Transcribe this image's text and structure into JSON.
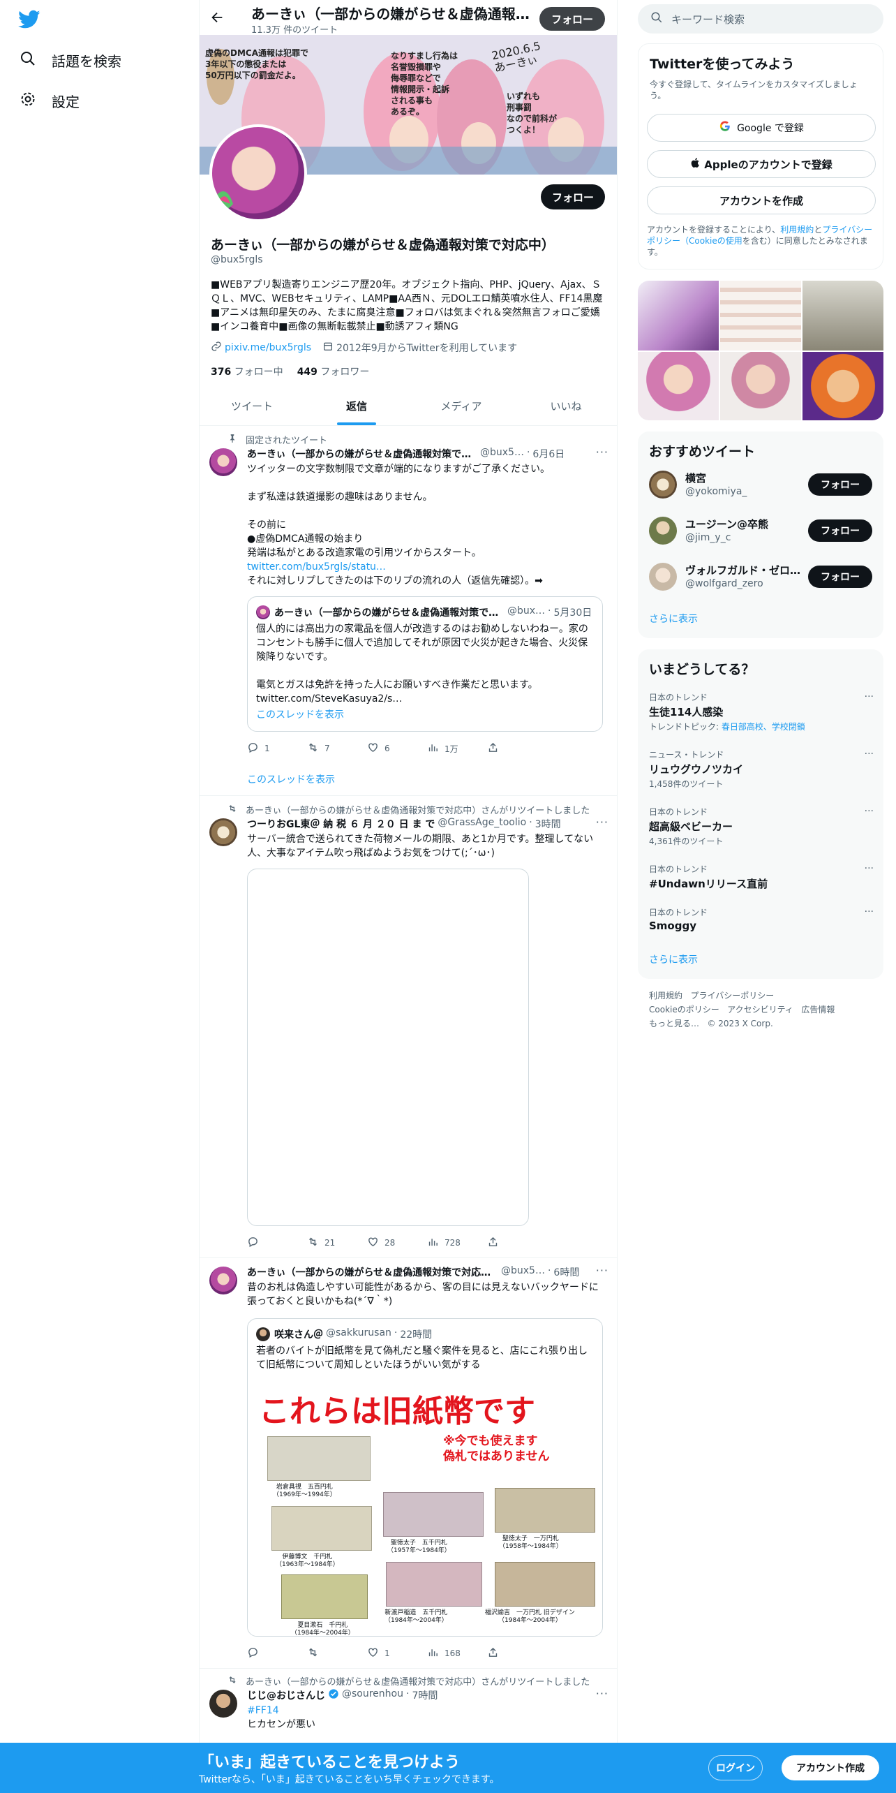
{
  "nav": {
    "search": "話題を検索",
    "settings": "設定"
  },
  "topbar": {
    "name": "あーきぃ（一部からの嫌がらせ＆虚偽通報対策で対応中）",
    "count": "11.3万 件のツイート",
    "follow": "フォロー"
  },
  "banner": {
    "caption1": "虚偽のDMCA通報は犯罪で\n3年以下の懲役または\n50万円以下の罰金だよ。",
    "caption2": "なりすまし行為は\n名誉毀損罪や\n侮辱罪などで\n情報開示・起訴\nされる事も\nあるぞ。",
    "caption3": "いずれも\n刑事罰\nなので前科が\nつくよ！",
    "signature": "2020.6.5\nあーきぃ"
  },
  "profile": {
    "name": "あーきぃ（一部からの嫌がらせ＆虚偽通報対策で対応中）",
    "handle": "@bux5rgls",
    "bio": "■WEBアプリ製造寄りエンジニア歴20年。オブジェクト指向、PHP、jQuery、Ajax、ＳＱＬ、MVC、WEBセキュリティ、LAMP■AA西Ｎ、元DOLエロ鯖英噴水住人、FF14黒魔■アニメは無印星矢のみ、たまに腐臭注意■フォロバは気まぐれ＆突然無言フォロご愛嬌■インコ養育中■画像の無断転載禁止■動誘アフィ類NG",
    "link": "pixiv.me/bux5rgls",
    "joined": "2012年9月からTwitterを利用しています",
    "following_count": "376",
    "following_label": "フォロー中",
    "followers_count": "449",
    "followers_label": "フォロワー",
    "follow": "フォロー"
  },
  "tabs": [
    "ツイート",
    "返信",
    "メディア",
    "いいね"
  ],
  "tweets": [
    {
      "social": "固定されたツイート",
      "name": "あーきぃ（一部からの嫌がらせ＆虚偽通報対策で対応中）",
      "handle": "@bux5…",
      "time": "6月6日",
      "text": "ツイッターの文字数制限で文章が端的になりますがご了承ください。\n\nまず私達は鉄道撮影の趣味はありません。\n\nその前に\n●虚偽DMCA通報の始まり\n発端は私がとある改造家電の引用ツイからスタート。",
      "link": "twitter.com/bux5rgls/statu…",
      "text2": "それに対しリプしてきたのは下のリプの流れの人（返信先確認）。➡",
      "quote": {
        "name": "あーきぃ（一部からの嫌がらせ＆虚偽通報対策で対応中）",
        "handle": "@bux…",
        "time": "5月30日",
        "text": "個人的には高出力の家電品を個人が改造するのはお勧めしないわねー。家のコンセントも勝手に個人で追加してそれが原因で火災が起きた場合、火災保険降りないです。\n\n電気とガスは免許を持った人にお願いすべき作業だと思います。\ntwitter.com/SteveKasuya2/s…",
        "show": "このスレッドを表示"
      },
      "replies": "1",
      "retweets": "7",
      "likes": "6",
      "views": "1万",
      "show_thread": "このスレッドを表示"
    },
    {
      "social": "あーきぃ（一部からの嫌がらせ＆虚偽通報対策で対応中）さんがリツイートしました",
      "name": "つーりおGL東＠ 納 税 ６ 月 ２０ 日 ま で",
      "handle": "@GrassAge_toolio",
      "time": "3時間",
      "text": "サーバー統合で送られてきた荷物メールの期限、あと1か月です。整理してない人、大事なアイテム吹っ飛ばぬようお気をつけて(;´･ω･)",
      "replies": "",
      "retweets": "21",
      "likes": "28",
      "views": "728"
    },
    {
      "name": "あーきぃ（一部からの嫌がらせ＆虚偽通報対策で対応中）",
      "handle": "@bux5…",
      "time": "6時間",
      "text": "昔のお札は偽造しやすい可能性があるから、客の目には見えないバックヤードに張っておくと良いかもね(*´∇｀*)",
      "quote": {
        "name": "咲来さん＠",
        "handle": "@sakkurusan",
        "time": "22時間",
        "text": "若者のバイトが旧紙幣を見て偽札だと騒ぐ案件を見ると、店にこれ張り出して旧紙幣について周知しといたほうがいい気がする",
        "image_title": "これらは旧紙幣です",
        "image_note": "※今でも使えます\n偽札ではありません",
        "notes": [
          "岩倉具視　五百円札\n（1969年～1994年）",
          "伊藤博文　千円札\n（1963年～1984年）",
          "夏目漱石　千円札\n（1984年～2004年）",
          "聖徳太子　五千円札\n（1957年～1984年）",
          "新渡戸稲造　五千円札\n（1984年～2004年）",
          "聖徳太子　一万円札\n（1958年～1984年）",
          "福沢諭吉　一万円札 旧デザイン\n（1984年～2004年）"
        ]
      },
      "replies": "",
      "retweets": "",
      "likes": "1",
      "views": "168"
    },
    {
      "social": "あーきぃ（一部からの嫌がらせ＆虚偽通報対策で対応中）さんがリツイートしました",
      "name": "じじ@おじさんじ",
      "handle": "@sourenhou",
      "time": "7時間",
      "hashtag": "#FF14",
      "text": "ヒカセンが悪い"
    }
  ],
  "right": {
    "search_placeholder": "キーワード検索",
    "signup": {
      "title": "Twitterを使ってみよう",
      "sub": "今すぐ登録して、タイムラインをカスタマイズしましょう。",
      "google": "Google で登録",
      "apple": "Appleのアカウントで登録",
      "create": "アカウントを作成",
      "legal_pre": "アカウントを登録することにより、",
      "legal_terms": "利用規約",
      "legal_and": "と",
      "legal_privacy": "プライバシーポリシー（Cookieの使用",
      "legal_post": "を含む）に同意したとみなされます。"
    },
    "recommend": {
      "title": "おすすめツイート",
      "users": [
        {
          "name": "横宮",
          "handle": "@yokomiya_"
        },
        {
          "name": "ユージーン@卒熊",
          "handle": "@jim_y_c"
        },
        {
          "name": "ヴォルフガルド・ゼロ…",
          "handle": "@wolfgard_zero"
        }
      ],
      "follow": "フォロー",
      "more": "さらに表示"
    },
    "trends": {
      "title": "いまどうしてる？",
      "items": [
        {
          "context": "日本のトレンド",
          "name": "生徒114人感染",
          "sub_label": "トレンドトピック: ",
          "sub_link": "春日部高校、学校閉鎖"
        },
        {
          "context": "ニュース・トレンド",
          "name": "リュウグウノツカイ",
          "sub": "1,458件のツイート"
        },
        {
          "context": "日本のトレンド",
          "name": "超高級ベビーカー",
          "sub": "4,361件のツイート"
        },
        {
          "context": "日本のトレンド",
          "name": "#Undawnリリース直前",
          "sub": ""
        },
        {
          "context": "日本のトレンド",
          "name": "Smoggy",
          "sub": ""
        }
      ],
      "more": "さらに表示"
    },
    "footer": [
      "利用規約",
      "プライバシーポリシー",
      "Cookieのポリシー",
      "アクセシビリティ",
      "広告情報",
      "もっと見る…",
      "© 2023 X Corp."
    ]
  },
  "bottombar": {
    "title": "「いま」起きていることを見つけよう",
    "sub": "Twitterなら、「いま」起きていることをいち早くチェックできます。",
    "login": "ログイン",
    "signup": "アカウント作成"
  },
  "colors": {
    "accent": "#1d9bf0",
    "text": "#0f1419",
    "muted": "#536471"
  }
}
